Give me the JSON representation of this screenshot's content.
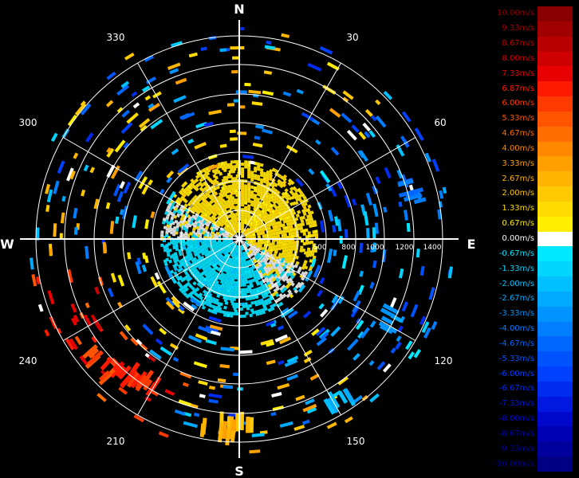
{
  "compass": {
    "north": "N",
    "south": "S",
    "east": "E",
    "west": "W"
  },
  "bearings": [
    "30",
    "60",
    "120",
    "150",
    "210",
    "240",
    "300",
    "330"
  ],
  "range_labels": [
    "600",
    "800",
    "1000",
    "1200",
    "1400"
  ],
  "legend": {
    "entries": [
      {
        "label": "10.00m/s",
        "color": "#8a0000"
      },
      {
        "label": "9.33m/s",
        "color": "#a00000"
      },
      {
        "label": "8.67m/s",
        "color": "#b80000"
      },
      {
        "label": "8.00m/s",
        "color": "#d00000"
      },
      {
        "label": "7.33m/s",
        "color": "#e80000"
      },
      {
        "label": "6.87m/s",
        "color": "#ff1a00"
      },
      {
        "label": "6.00m/s",
        "color": "#ff3a00"
      },
      {
        "label": "5.33m/s",
        "color": "#ff5500"
      },
      {
        "label": "4.67m/s",
        "color": "#ff6e00"
      },
      {
        "label": "4.00m/s",
        "color": "#ff8800"
      },
      {
        "label": "3.33m/s",
        "color": "#ffa000"
      },
      {
        "label": "2.67m/s",
        "color": "#ffb400"
      },
      {
        "label": "2.00m/s",
        "color": "#ffc800"
      },
      {
        "label": "1.33m/s",
        "color": "#ffdc00"
      },
      {
        "label": "0.67m/s",
        "color": "#ffee00"
      },
      {
        "label": "0.00m/s",
        "color": "#ffffff"
      },
      {
        "label": "-0.67m/s",
        "color": "#00e8ff"
      },
      {
        "label": "-1.33m/s",
        "color": "#00d4ff"
      },
      {
        "label": "-2.00m/s",
        "color": "#00c0ff"
      },
      {
        "label": "-2.67m/s",
        "color": "#00aaff"
      },
      {
        "label": "-3.33m/s",
        "color": "#0094ff"
      },
      {
        "label": "-4.00m/s",
        "color": "#007eff"
      },
      {
        "label": "-4.67m/s",
        "color": "#0068ff"
      },
      {
        "label": "-5.33m/s",
        "color": "#0054ff"
      },
      {
        "label": "-6.00m/s",
        "color": "#0040ff"
      },
      {
        "label": "-6.67m/s",
        "color": "#002cf0"
      },
      {
        "label": "-7.33m/s",
        "color": "#0018e0"
      },
      {
        "label": "-8.00m/s",
        "color": "#0008cc"
      },
      {
        "label": "-8.67m/s",
        "color": "#0000b4"
      },
      {
        "label": "-9.33m/s",
        "color": "#00009c"
      },
      {
        "label": "-10.00m/s",
        "color": "#000084"
      }
    ]
  },
  "colors": {
    "grid": "#ffffff",
    "background": "#000000",
    "approaching_core": "#f0d400",
    "receding_core": "#00d0e8",
    "neutral": "#d8d8d8"
  }
}
